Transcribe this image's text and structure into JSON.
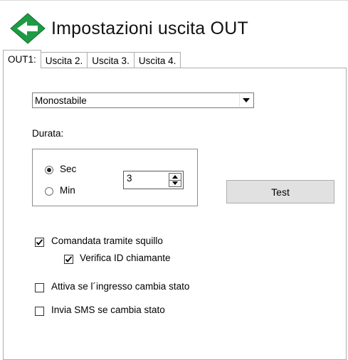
{
  "header": {
    "title": "Impostazioni uscita OUT",
    "icon": "back-arrow-icon"
  },
  "tabs": [
    {
      "label": "OUT1:",
      "active": true
    },
    {
      "label": "Uscita 2.",
      "active": false
    },
    {
      "label": "Uscita 3.",
      "active": false
    },
    {
      "label": "Uscita 4.",
      "active": false
    }
  ],
  "mode": {
    "selected": "Monostabile"
  },
  "duration": {
    "label": "Durata:",
    "options": [
      {
        "label": "Sec",
        "checked": true
      },
      {
        "label": "Min",
        "checked": false
      }
    ],
    "value": "3"
  },
  "test_button": "Test",
  "checkboxes": {
    "ring": {
      "label": "Comandata tramite squillo",
      "checked": true
    },
    "caller_id": {
      "label": "Verifica ID chiamante",
      "checked": true
    },
    "input_change": {
      "label": "Attiva se l´ingresso cambia stato",
      "checked": false
    },
    "sms": {
      "label": "Invia SMS se cambia stato",
      "checked": false
    }
  },
  "colors": {
    "icon_green": "#1e9b44",
    "button_bg": "#e1e1e1"
  }
}
